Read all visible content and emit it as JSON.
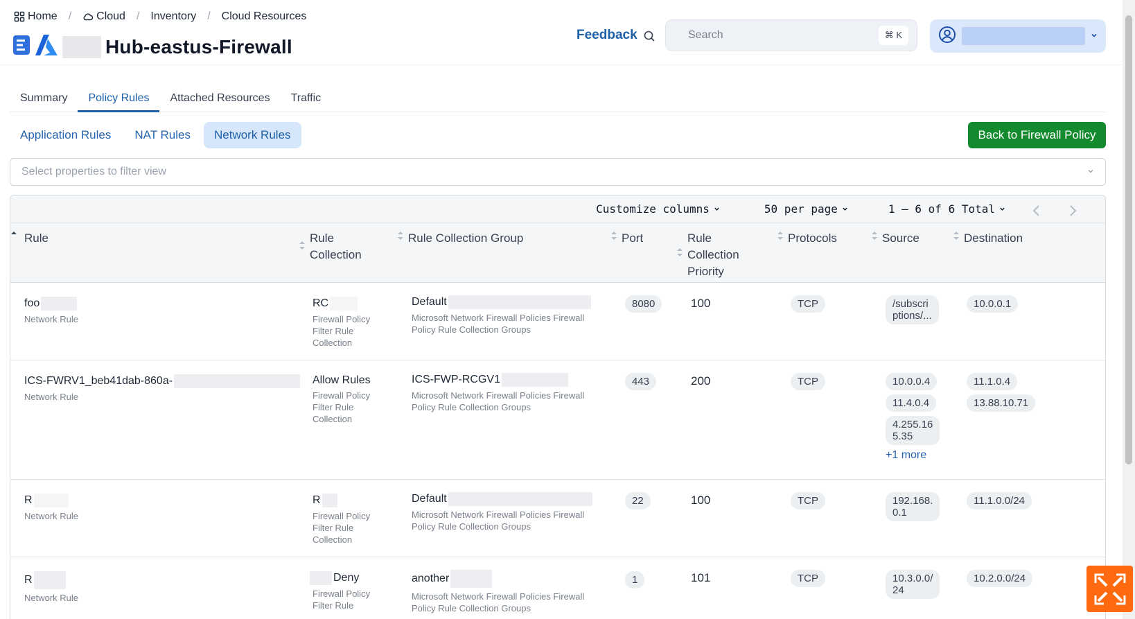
{
  "breadcrumb": {
    "home": "Home",
    "cloud": "Cloud",
    "inventory": "Inventory",
    "cloud_resources": "Cloud Resources",
    "separator": "/"
  },
  "page": {
    "title": "Hub-eastus-Firewall"
  },
  "header": {
    "feedback": "Feedback",
    "search_placeholder": "Search",
    "search_shortcut": "⌘ K"
  },
  "tabs": [
    "Summary",
    "Policy Rules",
    "Attached Resources",
    "Traffic"
  ],
  "subtabs": [
    "Application Rules",
    "NAT Rules",
    "Network Rules"
  ],
  "back_button": "Back to Firewall Policy",
  "filter_placeholder": "Select properties to filter view",
  "toolbar": {
    "customize": "Customize columns",
    "per_page": "50 per page",
    "range": "1 – 6 of 6 Total"
  },
  "columns": {
    "rule": "Rule",
    "rule_collection_1": "Rule",
    "rule_collection_2": "Collection",
    "group": "Rule Collection Group",
    "port": "Port",
    "priority_1": "Rule",
    "priority_2": "Collection",
    "priority_3": "Priority",
    "protocols": "Protocols",
    "source": "Source",
    "destination": "Destination"
  },
  "rows": [
    {
      "rule": "foo",
      "rule_type": "Network Rule",
      "collection": "RC",
      "collection_type": [
        "Firewall Policy",
        "Filter Rule",
        "Collection"
      ],
      "group": "Default",
      "group_type": [
        "Microsoft Network Firewall Policies Firewall",
        "Policy Rule Collection Groups"
      ],
      "port": "8080",
      "priority": "100",
      "protocol": "TCP",
      "sources": [
        "/subscri",
        "ptions/..."
      ],
      "destinations": [
        "10.0.0.1"
      ]
    },
    {
      "rule": "ICS-FWRV1_beb41dab-860a-",
      "rule_type": "Network Rule",
      "collection": "Allow Rules",
      "collection_type": [
        "Firewall Policy",
        "Filter Rule",
        "Collection"
      ],
      "group": "ICS-FWP-RCGV1",
      "group_type": [
        "Microsoft Network Firewall Policies Firewall",
        "Policy Rule Collection Groups"
      ],
      "port": "443",
      "priority": "200",
      "protocol": "TCP",
      "sources": [
        "10.0.0.4",
        "11.4.0.4",
        "4.255.16",
        "5.35"
      ],
      "more": "+1 more",
      "destinations": [
        "11.1.0.4",
        "13.88.10.71"
      ]
    },
    {
      "rule": "R",
      "rule_type": "Network Rule",
      "collection": "R",
      "collection_type": [
        "Firewall Policy",
        "Filter Rule",
        "Collection"
      ],
      "group": "Default",
      "group_type": [
        "Microsoft Network Firewall Policies Firewall",
        "Policy Rule Collection Groups"
      ],
      "port": "22",
      "priority": "100",
      "protocol": "TCP",
      "sources": [
        "192.168.",
        "0.1"
      ],
      "destinations": [
        "11.1.0.0/24"
      ]
    },
    {
      "rule": "R",
      "rule_type": "Network Rule",
      "collection": "Deny",
      "collection_type": [
        "Firewall Policy",
        "Filter Rule"
      ],
      "group": "another",
      "group_type": [
        "Microsoft Network Firewall Policies Firewall",
        "Policy Rule Collection Groups"
      ],
      "port": "1",
      "priority": "101",
      "protocol": "TCP",
      "sources": [
        "10.3.0.0/",
        "24"
      ],
      "destinations": [
        "10.2.0.0/24"
      ]
    }
  ],
  "colors": {
    "accent": "#1d5fa8",
    "primary_button": "#138a2e",
    "widget": "#ff6a10"
  }
}
